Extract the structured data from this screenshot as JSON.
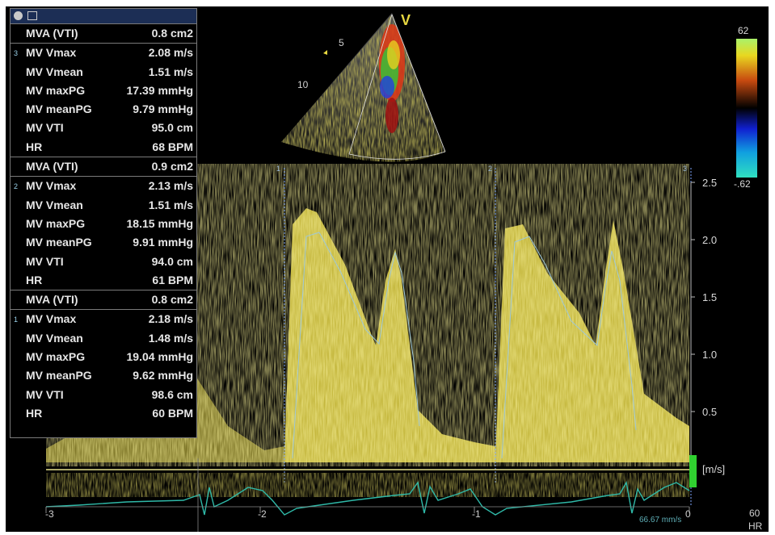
{
  "measurement_panel": {
    "blocks": [
      {
        "beat_index": "3",
        "rows": [
          {
            "label": "MVA (VTI)",
            "value": "0.8 cm2"
          },
          {
            "label": "MV Vmax",
            "value": "2.08 m/s"
          },
          {
            "label": "MV Vmean",
            "value": "1.51 m/s"
          },
          {
            "label": "MV maxPG",
            "value": "17.39 mmHg"
          },
          {
            "label": "MV meanPG",
            "value": "9.79 mmHg"
          },
          {
            "label": "MV VTI",
            "value": "95.0 cm"
          },
          {
            "label": "HR",
            "value": "68 BPM"
          }
        ]
      },
      {
        "beat_index": "2",
        "rows": [
          {
            "label": "MVA (VTI)",
            "value": "0.9 cm2"
          },
          {
            "label": "MV Vmax",
            "value": "2.13 m/s"
          },
          {
            "label": "MV Vmean",
            "value": "1.51 m/s"
          },
          {
            "label": "MV maxPG",
            "value": "18.15 mmHg"
          },
          {
            "label": "MV meanPG",
            "value": "9.91 mmHg"
          },
          {
            "label": "MV VTI",
            "value": "94.0 cm"
          },
          {
            "label": "HR",
            "value": "61 BPM"
          }
        ]
      },
      {
        "beat_index": "1",
        "rows": [
          {
            "label": "MVA (VTI)",
            "value": "0.8 cm2"
          },
          {
            "label": "MV Vmax",
            "value": "2.18 m/s"
          },
          {
            "label": "MV Vmean",
            "value": "1.48 m/s"
          },
          {
            "label": "MV maxPG",
            "value": "19.04 mmHg"
          },
          {
            "label": "MV meanPG",
            "value": "9.62 mmHg"
          },
          {
            "label": "MV VTI",
            "value": "98.6 cm"
          },
          {
            "label": "HR",
            "value": "60 BPM"
          }
        ]
      }
    ]
  },
  "color_scale": {
    "max": "62",
    "min": "-.62"
  },
  "probe_marker": "V",
  "depth_labels": [
    "5",
    "10"
  ],
  "velocity_scale": {
    "ticks": [
      "2.5",
      "2.0",
      "1.5",
      "1.0",
      "0.5"
    ],
    "unit": "[m/s]"
  },
  "beat_markers": [
    "1",
    "2",
    "3"
  ],
  "time_axis": [
    "-3",
    "-2",
    "-1",
    "0"
  ],
  "sweep_speed": "66.67 mm/s",
  "heart_rate": {
    "value": "60",
    "label": "HR"
  },
  "colors": {
    "doppler": "#e8d84a",
    "trace": "#9ec8d8",
    "ecg": "#2fb9a8",
    "baseline": "#e6e08c",
    "panel_border": "#7a7a7a",
    "panel_text": "#e6e6e6"
  }
}
